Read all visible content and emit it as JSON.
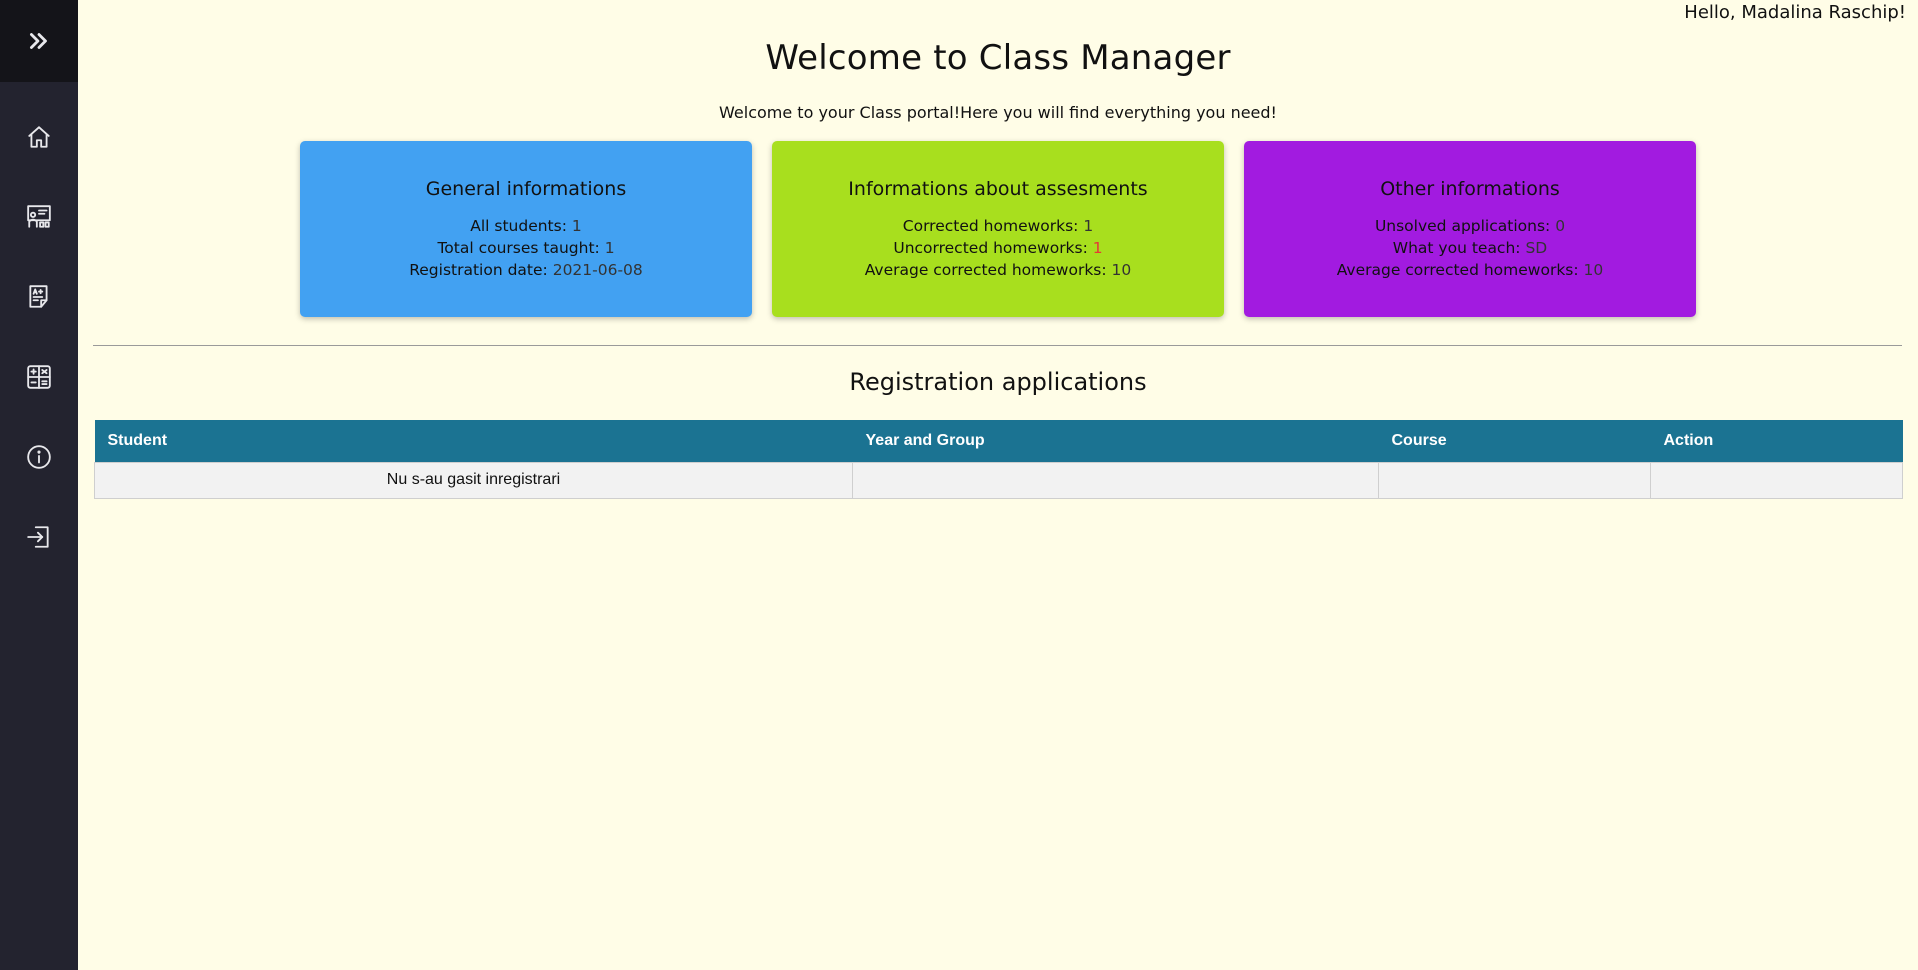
{
  "header": {
    "greeting": "Hello, Madalina Raschip!"
  },
  "sidebar": {
    "toggle_icon": "double-chevron-right-icon",
    "items": [
      {
        "icon": "home-icon"
      },
      {
        "icon": "teacher-board-icon"
      },
      {
        "icon": "grades-document-icon"
      },
      {
        "icon": "calculator-icon"
      },
      {
        "icon": "info-icon"
      },
      {
        "icon": "logout-icon"
      }
    ]
  },
  "main": {
    "title": "Welcome to Class Manager",
    "subtitle": "Welcome to your Class portal!Here you will find everything you need!",
    "cards": [
      {
        "title": "General informations",
        "color": "#42a1f2",
        "rows": [
          {
            "label": "All students:",
            "value": "1"
          },
          {
            "label": "Total courses taught:",
            "value": "1"
          },
          {
            "label": "Registration date:",
            "value": "2021-06-08"
          }
        ]
      },
      {
        "title": "Informations about assesments",
        "color": "#a8df1e",
        "rows": [
          {
            "label": "Corrected homeworks:",
            "value": "1"
          },
          {
            "label": "Uncorrected homeworks:",
            "value": "1"
          },
          {
            "label": "Average corrected homeworks:",
            "value": "10"
          }
        ]
      },
      {
        "title": "Other informations",
        "color": "#a21be0",
        "rows": [
          {
            "label": "Unsolved applications:",
            "value": "0"
          },
          {
            "label": "What you teach:",
            "value": "SD"
          },
          {
            "label": "Average corrected homeworks:",
            "value": "10"
          }
        ]
      }
    ],
    "applications": {
      "title": "Registration applications",
      "columns": [
        "Student",
        "Year and Group",
        "Course",
        "Action"
      ],
      "empty_message": "Nu s-au gasit inregistrari"
    }
  },
  "colors": {
    "background": "#fffde7",
    "sidebar": "#23232f",
    "table_header": "#1b7392",
    "alert": "#e53935"
  }
}
